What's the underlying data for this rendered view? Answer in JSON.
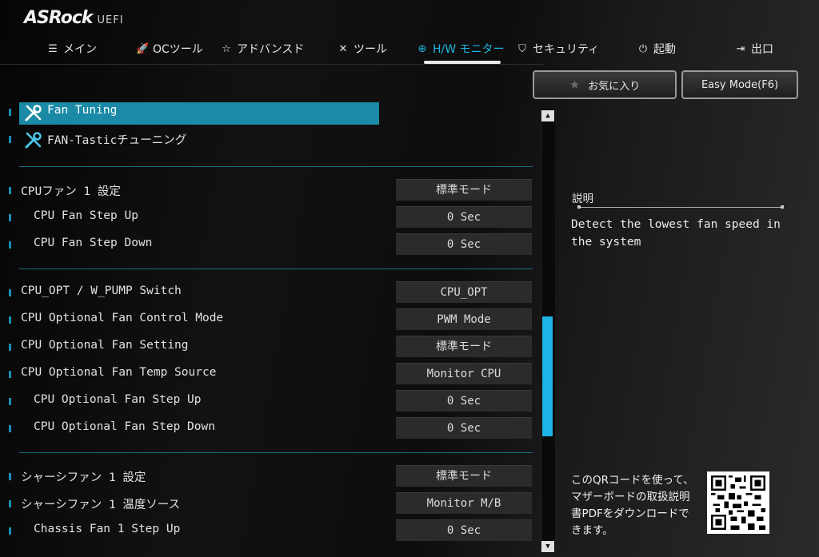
{
  "header": {
    "brand": "ASRock",
    "subtitle": "UEFI"
  },
  "nav": {
    "tabs": [
      {
        "label": "メイン",
        "icon": "list-icon"
      },
      {
        "label": "OCツール",
        "icon": "rocket-icon"
      },
      {
        "label": "アドバンスド",
        "icon": "star-icon"
      },
      {
        "label": "ツール",
        "icon": "tools-icon"
      },
      {
        "label": "H/W モニター",
        "icon": "monitor-icon",
        "active": true
      },
      {
        "label": "セキュリティ",
        "icon": "shield-icon"
      },
      {
        "label": "起動",
        "icon": "power-icon"
      },
      {
        "label": "出口",
        "icon": "exit-icon"
      }
    ]
  },
  "buttons": {
    "favorites": "お気に入り",
    "easy_mode": "Easy Mode(F6)"
  },
  "rows": [
    {
      "label": "Fan Tuning",
      "type": "tool",
      "selected": true
    },
    {
      "label": "FAN-Tasticチューニング",
      "type": "tool"
    },
    {
      "label": "CPUファン 1 設定",
      "value": "標準モード"
    },
    {
      "label": "CPU Fan Step Up",
      "value": "0 Sec"
    },
    {
      "label": "CPU Fan Step Down",
      "value": "0 Sec"
    },
    {
      "label": "CPU_OPT / W_PUMP Switch",
      "value": "CPU_OPT"
    },
    {
      "label": "CPU Optional Fan Control Mode",
      "value": "PWM Mode"
    },
    {
      "label": "CPU Optional Fan Setting",
      "value": "標準モード"
    },
    {
      "label": "CPU Optional Fan Temp Source",
      "value": "Monitor CPU"
    },
    {
      "label": "CPU Optional Fan Step Up",
      "value": "0 Sec"
    },
    {
      "label": "CPU Optional Fan Step Down",
      "value": "0 Sec"
    },
    {
      "label": "シャーシファン 1 設定",
      "value": "標準モード"
    },
    {
      "label": "シャーシファン 1 温度ソース",
      "value": "Monitor M/B"
    },
    {
      "label": "Chassis Fan 1 Step Up",
      "value": "0 Sec"
    }
  ],
  "description": {
    "title": "説明",
    "text": "Detect the lowest fan speed in the system"
  },
  "qr": {
    "text": "このQRコードを使って、マザーボードの取扱説明書PDFをダウンロードできます。"
  },
  "colors": {
    "accent": "#1fb6e0",
    "highlight": "#1a8aa6"
  }
}
